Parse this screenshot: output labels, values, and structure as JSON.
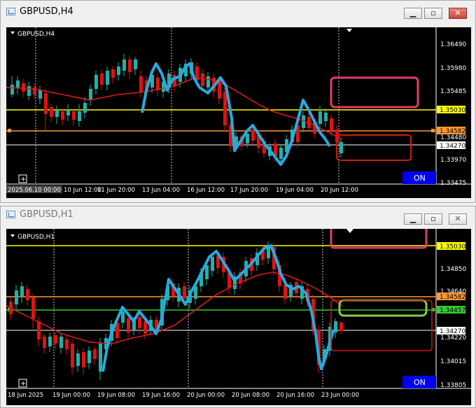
{
  "colors": {
    "bull": "#20b2aa",
    "bear": "#dc1414",
    "ma": "#e31b1b",
    "wave": "#29a9e0",
    "line_yellow": "#ffff00",
    "line_orange": "#ff9933",
    "line_green": "#33cc33",
    "line_white": "#ffffff",
    "box_pink": "#e23a6e",
    "box_red": "#d01818",
    "box_green": "#88cc44",
    "on_bg": "#0000ee"
  },
  "icons": {
    "app": "chart-window-icon",
    "minimize": "minimize-icon",
    "maximize": "maximize-icon",
    "close": "close-icon",
    "zoom": "plus-icon",
    "shift": "triangle-down-icon"
  },
  "windows": [
    {
      "title": "GBPUSD,H4",
      "label": "GBPUSD,H4",
      "on_label": "ON",
      "yaxis": [
        "1.36490",
        "1.35980",
        "1.35485",
        "1.34480",
        "1.33970",
        "1.33475"
      ],
      "price_tags": [
        {
          "text": "1.35030",
          "bg": "#ffff00",
          "fg": "#000000"
        },
        {
          "text": "1.34582",
          "bg": "#ff9933",
          "fg": "#000000"
        },
        {
          "text": "1.34270",
          "bg": "#ffffff",
          "fg": "#000000"
        }
      ],
      "xaxis": [
        "2025.06.10 00:00",
        "10 Jun 12:00",
        "11 Jun 20:00",
        "13 Jun 04:00",
        "16 Jun 12:00",
        "17 Jun 20:00",
        "19 Jun 04:00",
        "20 Jun 12:00"
      ]
    },
    {
      "title": "GBPUSD,H1",
      "label": "GBPUSD,H1",
      "on_label": "ON",
      "yaxis": [
        "1.34850",
        "1.34640",
        "1.34220",
        "1.34015",
        "1.33805"
      ],
      "price_tags": [
        {
          "text": "1.35030",
          "bg": "#ffff00",
          "fg": "#000000"
        },
        {
          "text": "1.34582",
          "bg": "#ff9933",
          "fg": "#000000"
        },
        {
          "text": "1.34457",
          "bg": "#33cc33",
          "fg": "#000000"
        },
        {
          "text": "1.34270",
          "bg": "#ffffff",
          "fg": "#000000"
        }
      ],
      "xaxis": [
        "18 Jun 2025",
        "19 Jun 00:00",
        "19 Jun 08:00",
        "19 Jun 16:00",
        "20 Jun 00:00",
        "20 Jun 08:00",
        "20 Jun 16:00",
        "23 Jun 00:00"
      ]
    }
  ]
}
